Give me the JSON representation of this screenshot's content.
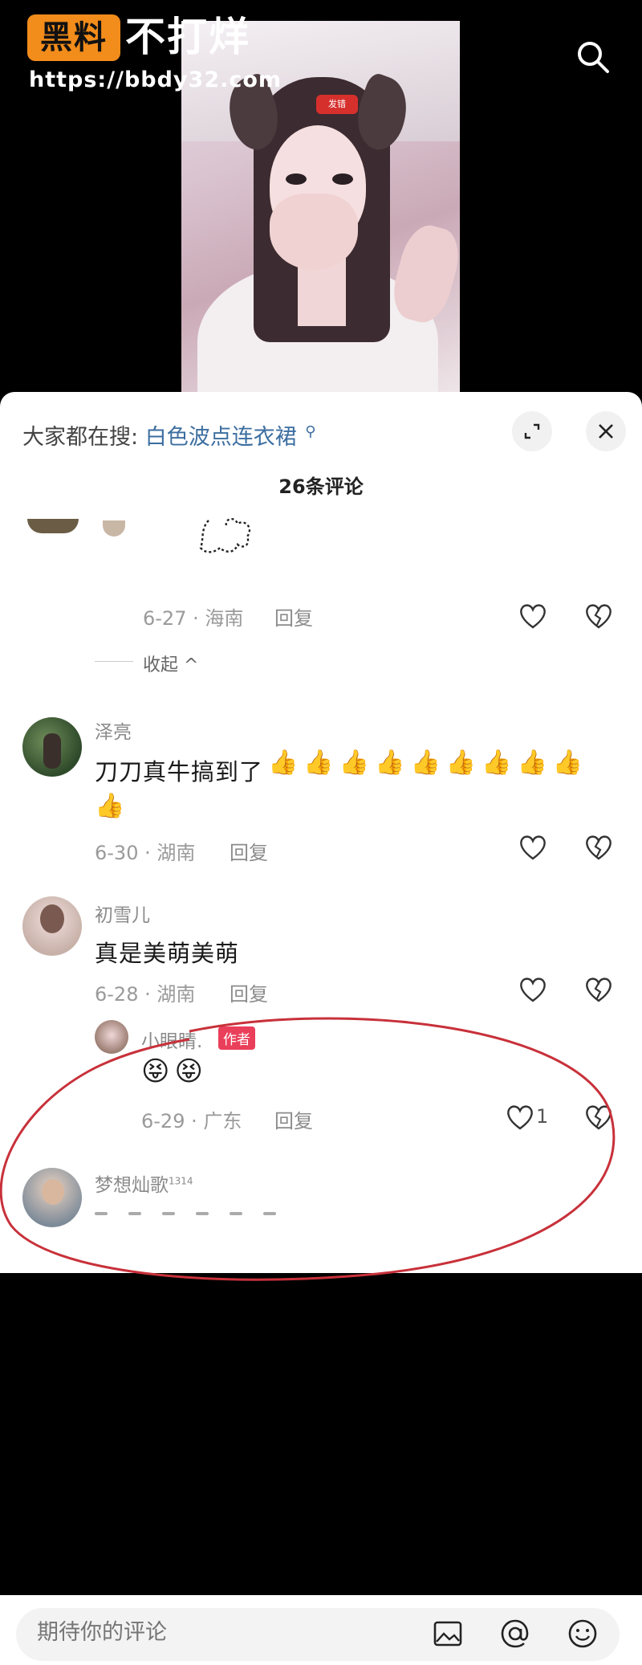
{
  "watermark": {
    "brand_box": "黑料",
    "brand_title": "不打烊",
    "url": "https://bbdy32.com"
  },
  "video": {
    "badge": "发错"
  },
  "sheet": {
    "hot_search_label": "大家都在搜:",
    "hot_search_term": "白色波点连衣裙",
    "comment_count": "26条评论",
    "collapse_label": "收起 ^"
  },
  "comments": [
    {
      "meta": "6-27 · 海南",
      "reply": "回复"
    },
    {
      "username": "泽亮",
      "text": "刀刀真牛搞到了",
      "thumbs": 10,
      "meta": "6-30 · 湖南",
      "reply": "回复"
    },
    {
      "username": "初雪儿",
      "text": "真是美萌美萌",
      "meta": "6-28 · 湖南",
      "reply": "回复"
    },
    {
      "username": "小眼睛.",
      "author_tag": "作者",
      "meta": "6-29 · 广东",
      "reply": "回复",
      "likes": "1"
    },
    {
      "username": "梦想灿歌",
      "username_sup": "1314"
    }
  ],
  "input": {
    "placeholder": "期待你的评论"
  },
  "colors": {
    "accent_link": "#3c6ea0",
    "author_tag": "#ea3f5a",
    "annotation_red": "#c8313a",
    "brand_orange": "#f28c1b"
  },
  "icons": [
    "search-icon",
    "expand-icon",
    "close-icon",
    "heart-icon",
    "broken-heart-icon",
    "image-icon",
    "at-icon",
    "emoji-icon"
  ]
}
